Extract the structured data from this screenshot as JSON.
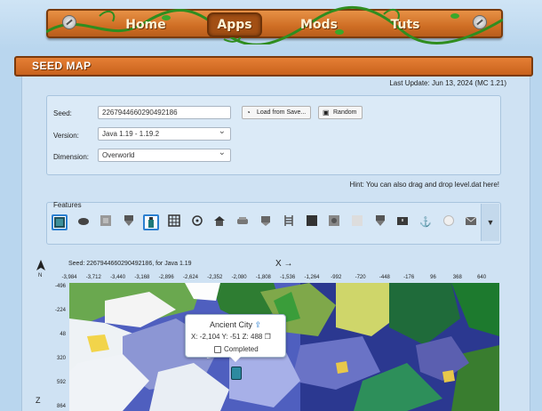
{
  "nav": {
    "items": [
      {
        "label": "Home",
        "active": false
      },
      {
        "label": "Apps",
        "active": true
      },
      {
        "label": "Mods",
        "active": false
      },
      {
        "label": "Tuts",
        "active": false
      }
    ]
  },
  "section": {
    "title": "SEED MAP"
  },
  "last_update": "Last Update: Jun 13, 2024 (MC 1.21)",
  "form": {
    "seed_label": "Seed:",
    "seed_value": "2267944660290492186",
    "load_button": "Load from Save...",
    "random_button": "Random",
    "version_label": "Version:",
    "version_value": "Java 1.19 - 1.19.2",
    "dimension_label": "Dimension:",
    "dimension_value": "Overworld"
  },
  "hint": "Hint: You can also drag and drop level.dat here!",
  "features": {
    "label": "Features",
    "icons": [
      "ancient-city-icon",
      "shipwreck-icon",
      "ocean-monument-icon",
      "outpost-icon",
      "trail-ruins-icon",
      "stronghold-icon",
      "spawn-icon",
      "village-icon",
      "mineshaft-icon",
      "pillager-icon",
      "ladder-icon",
      "end-city-icon",
      "portal-icon",
      "igloo-icon",
      "tower-icon",
      "chest-icon",
      "anchor-icon",
      "pearl-icon",
      "mail-icon"
    ]
  },
  "map": {
    "seed_line": "Seed: 2267944660290492186, for Java 1.19",
    "x_axis": "X →",
    "z_axis": "Z",
    "x_ticks": [
      "-3,984",
      "-3,712",
      "-3,440",
      "-3,168",
      "-2,896",
      "-2,624",
      "-2,352",
      "-2,080",
      "-1,808",
      "-1,536",
      "-1,264",
      "-992",
      "-720",
      "-448",
      "-176",
      "96",
      "368",
      "640"
    ],
    "y_ticks": [
      "-496",
      "-224",
      "48",
      "320",
      "592",
      "864"
    ],
    "popup": {
      "title": "Ancient City",
      "coords": "X: -2,104 Y: -51 Z: 488",
      "completed_label": "Completed"
    }
  },
  "colors": {
    "wood": "#cf6e24",
    "panel": "#cfe2f3",
    "accent": "#2b7fd0"
  }
}
